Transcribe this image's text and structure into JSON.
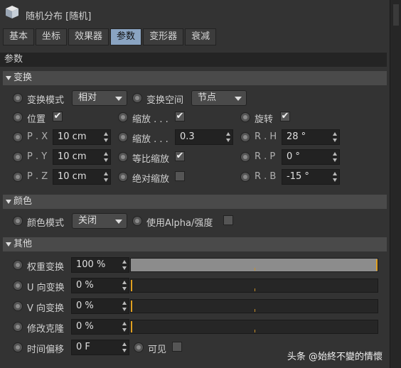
{
  "window": {
    "title": "随机分布 [随机]"
  },
  "tabs": [
    {
      "label": "基本",
      "active": false
    },
    {
      "label": "坐标",
      "active": false
    },
    {
      "label": "效果器",
      "active": false
    },
    {
      "label": "参数",
      "active": true
    },
    {
      "label": "变形器",
      "active": false
    },
    {
      "label": "衰减",
      "active": false
    }
  ],
  "section": {
    "title": "参数"
  },
  "transform": {
    "header": "变换",
    "mode_label": "变换模式",
    "mode_value": "相对",
    "space_label": "变换空间",
    "space_value": "节点",
    "position_label": "位置",
    "position_checked": "✔",
    "scale_label": "缩放 . . .",
    "scale_checked": "✔",
    "rotate_label": "旋转",
    "rotate_checked": "✔",
    "px_label": "P . X",
    "px_value": "10 cm",
    "py_label": "P . Y",
    "py_value": "10 cm",
    "pz_label": "P . Z",
    "pz_value": "10 cm",
    "scale2_label": "缩放 . . .",
    "scale2_value": "0.3",
    "uniform_label": "等比缩放",
    "uniform_checked": "✔",
    "absolute_label": "绝对缩放",
    "rh_label": "R . H",
    "rh_value": "28 °",
    "rp_label": "R . P",
    "rp_value": "0 °",
    "rb_label": "R . B",
    "rb_value": "-15 °"
  },
  "color": {
    "header": "颜色",
    "mode_label": "颜色模式",
    "mode_value": "关闭",
    "alpha_label": "使用Alpha/强度"
  },
  "other": {
    "header": "其他",
    "weight_label": "权重变换",
    "weight_value": "100 %",
    "weight_fraction": 1.0,
    "u_label": "U 向变换",
    "u_value": "0 %",
    "v_label": "V 向变换",
    "v_value": "0 %",
    "clone_label": "修改克隆",
    "clone_value": "0 %",
    "time_label": "时间偏移",
    "time_value": "0 F",
    "visible_label": "可见"
  },
  "watermark": "头条 @始終不變的情懷",
  "colors": {
    "active_tab": "#8aa4c2",
    "slider_cursor": "#e0a020",
    "panel": "#333333"
  }
}
